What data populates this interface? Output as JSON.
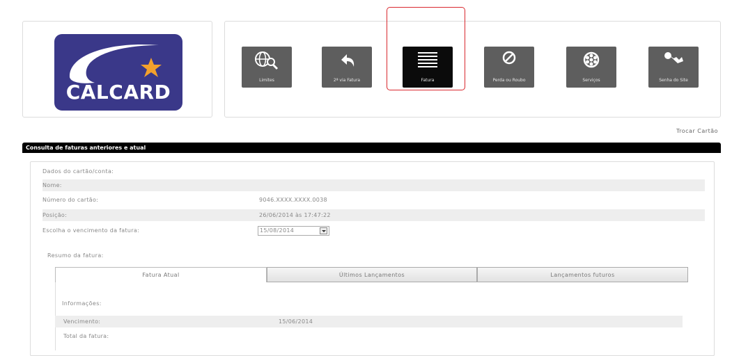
{
  "brand": {
    "name": "CALCARD",
    "color": "#3a3889",
    "accent": "#f4a12c"
  },
  "menu": [
    {
      "label": "Limites",
      "icon": "globe-search-icon",
      "active": false
    },
    {
      "label": "2ª via Fatura",
      "icon": "reply-arrow-icon",
      "active": false
    },
    {
      "label": "Fatura",
      "icon": "lines-icon",
      "active": true
    },
    {
      "label": "Perda ou Roubo",
      "icon": "prohibited-icon",
      "active": false
    },
    {
      "label": "Serviços",
      "icon": "wheel-icon",
      "active": false
    },
    {
      "label": "Senha do Site",
      "icon": "key-icon",
      "active": false
    }
  ],
  "highlight_color": "#d9272d",
  "trocar_cartao": "Trocar Cartão",
  "section_title": "Consulta de faturas anteriores e atual",
  "card_data": {
    "heading": "Dados do cartão/conta:",
    "nome_label": "Nome:",
    "nome_value": "",
    "numero_label": "Número do cartão:",
    "numero_value": "9046.XXXX.XXXX.0038",
    "posicao_label": "Posição:",
    "posicao_value": "26/06/2014 às 17:47:22",
    "vencimento_label": "Escolha o vencimento da fatura:",
    "vencimento_value": "15/08/2014"
  },
  "resumo": {
    "heading": "Resumo da fatura:",
    "tabs": [
      "Fatura Atual",
      "Últimos Lançamentos",
      "Lançamentos futuros"
    ],
    "active_tab": 0
  },
  "info": {
    "heading": "Informações:",
    "vencimento_label": "Vencimento:",
    "vencimento_value": "15/06/2014",
    "total_label": "Total da fatura:"
  }
}
